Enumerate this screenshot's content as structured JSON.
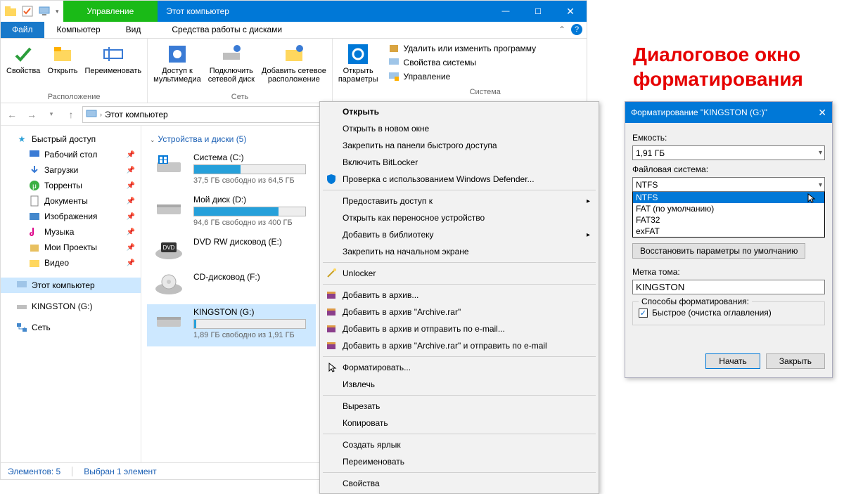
{
  "titlebar": {
    "manage_tab": "Управление",
    "window_title": "Этот компьютер"
  },
  "menutabs": {
    "file": "Файл",
    "computer": "Компьютер",
    "view": "Вид",
    "drive_tools": "Средства работы с дисками"
  },
  "ribbon": {
    "location": {
      "group_label": "Расположение",
      "properties": "Свойства",
      "open": "Открыть",
      "rename": "Переименовать"
    },
    "network": {
      "group_label": "Сеть",
      "media": "Доступ к\nмультимедиа",
      "map_drive": "Подключить\nсетевой диск",
      "add_location": "Добавить сетевое\nрасположение"
    },
    "settings": {
      "open_settings": "Открыть\nпараметры"
    },
    "system": {
      "group_label": "Система",
      "uninstall": "Удалить или изменить программу",
      "sys_props": "Свойства системы",
      "manage": "Управление"
    }
  },
  "address": {
    "path": "Этот компьютер"
  },
  "sidebar": {
    "quick_access": "Быстрый доступ",
    "desktop": "Рабочий стол",
    "downloads": "Загрузки",
    "torrents": "Торренты",
    "documents": "Документы",
    "pictures": "Изображения",
    "music": "Музыка",
    "projects": "Мои Проекты",
    "video": "Видео",
    "this_pc": "Этот компьютер",
    "kingston": "KINGSTON (G:)",
    "network": "Сеть"
  },
  "main": {
    "section": "Устройства и диски (5)",
    "drives": [
      {
        "name": "Система (C:)",
        "free": "37,5 ГБ свободно из 64,5 ГБ",
        "pct": 42
      },
      {
        "name": "Мой диск (D:)",
        "free": "94,6 ГБ свободно из 400 ГБ",
        "pct": 76
      },
      {
        "name": "DVD RW дисковод (E:)",
        "free": "",
        "pct": -1
      },
      {
        "name": "CD-дисковод (F:)",
        "free": "",
        "pct": -1
      },
      {
        "name": "KINGSTON (G:)",
        "free": "1,89 ГБ свободно из 1,91 ГБ",
        "pct": 2
      }
    ]
  },
  "ctx": {
    "open": "Открыть",
    "open_new": "Открыть в новом окне",
    "pin_qa": "Закрепить на панели быстрого доступа",
    "bitlocker": "Включить BitLocker",
    "defender": "Проверка с использованием Windows Defender...",
    "share": "Предоставить доступ к",
    "portable": "Открыть как переносное устройство",
    "library": "Добавить в библиотеку",
    "pin_start": "Закрепить на начальном экране",
    "unlocker": "Unlocker",
    "archive1": "Добавить в архив...",
    "archive2": "Добавить в архив \"Archive.rar\"",
    "archive3": "Добавить в архив и отправить по e-mail...",
    "archive4": "Добавить в архив \"Archive.rar\" и отправить по e-mail",
    "format": "Форматировать...",
    "eject": "Извлечь",
    "cut": "Вырезать",
    "copy": "Копировать",
    "shortcut": "Создать ярлык",
    "rename": "Переименовать",
    "properties": "Свойства"
  },
  "status": {
    "items": "Элементов: 5",
    "selected": "Выбран 1 элемент"
  },
  "side_heading": "Диалоговое окно\nформатирования",
  "fmt": {
    "title": "Форматирование \"KINGSTON (G:)\"",
    "capacity_label": "Емкость:",
    "capacity": "1,91 ГБ",
    "fs_label": "Файловая система:",
    "fs_selected": "NTFS",
    "fs_options": [
      "NTFS",
      "FAT (по умолчанию)",
      "FAT32",
      "exFAT"
    ],
    "reset": "Восстановить параметры по умолчанию",
    "volume_label": "Метка тома:",
    "volume": "KINGSTON",
    "methods_label": "Способы форматирования:",
    "quick": "Быстрое (очистка оглавления)",
    "start": "Начать",
    "close": "Закрыть"
  }
}
